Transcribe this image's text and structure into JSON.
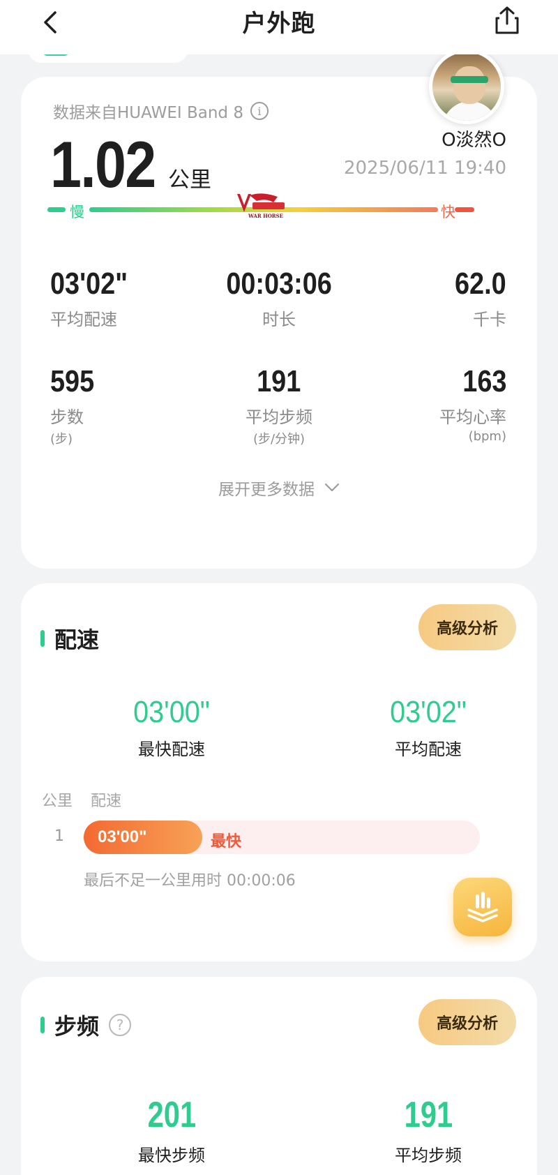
{
  "header": {
    "title": "户外跑"
  },
  "summary": {
    "source": "数据来自HUAWEI Band 8",
    "distance_value": "1.02",
    "distance_unit": "公里",
    "username": "O淡然O",
    "datetime": "2025/06/11 19:40",
    "pace_scale": {
      "slow_label": "慢",
      "fast_label": "快"
    },
    "watermark_text": "WAR HORSE",
    "stats": [
      {
        "value": "03'02\"",
        "label": "平均配速",
        "sub": ""
      },
      {
        "value": "00:03:06",
        "label": "时长",
        "sub": ""
      },
      {
        "value": "62.0",
        "label": "千卡",
        "sub": ""
      },
      {
        "value": "595",
        "label": "步数",
        "sub": "(步)"
      },
      {
        "value": "191",
        "label": "平均步频",
        "sub": "(步/分钟)"
      },
      {
        "value": "163",
        "label": "平均心率",
        "sub": "(bpm)"
      }
    ],
    "expand_label": "展开更多数据"
  },
  "pace_section": {
    "title": "配速",
    "advanced_label": "高级分析",
    "fastest_value": "03'00\"",
    "fastest_label": "最快配速",
    "average_value": "03'02\"",
    "average_label": "平均配速",
    "col_km": "公里",
    "col_pace": "配速",
    "splits": [
      {
        "km": "1",
        "pace": "03'00\"",
        "tag": "最快",
        "fraction": 0.3
      }
    ],
    "note": "最后不足一公里用时 00:00:06"
  },
  "cadence_section": {
    "title": "步频",
    "advanced_label": "高级分析",
    "fastest_value": "201",
    "fastest_label": "最快步频",
    "average_value": "191",
    "average_label": "平均步频"
  },
  "colors": {
    "accent_green": "#2ecc8f",
    "fast_red": "#f0533e",
    "gold": "#f7c982"
  }
}
